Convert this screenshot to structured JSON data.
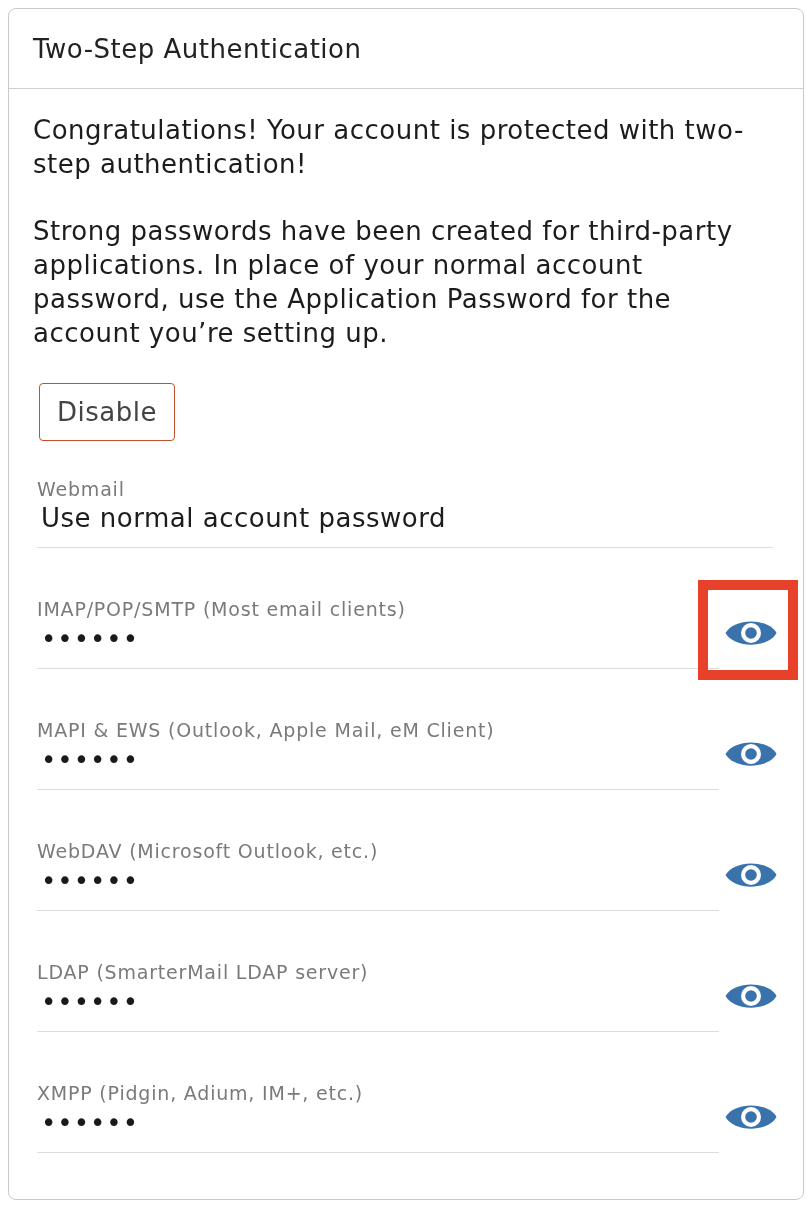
{
  "panel": {
    "title": "Two-Step Authentication"
  },
  "paragraphs": [
    "Congratulations! Your account is protected with two-step authentication!",
    "Strong passwords have been created for third-party applications. In place of your normal account password, use the Application Password for the account you’re setting up."
  ],
  "disable_button": {
    "label": "Disable"
  },
  "webmail": {
    "label": "Webmail",
    "value": "Use normal account password"
  },
  "app_passwords": [
    {
      "label": "IMAP/POP/SMTP (Most email clients)",
      "value": "••••••",
      "highlighted": true
    },
    {
      "label": "MAPI & EWS (Outlook, Apple Mail, eM Client)",
      "value": "••••••",
      "highlighted": false
    },
    {
      "label": "WebDAV (Microsoft Outlook, etc.)",
      "value": "••••••",
      "highlighted": false
    },
    {
      "label": "LDAP (SmarterMail LDAP server)",
      "value": "••••••",
      "highlighted": false
    },
    {
      "label": "XMPP (Pidgin, Adium, IM+, etc.)",
      "value": "••••••",
      "highlighted": false
    }
  ]
}
